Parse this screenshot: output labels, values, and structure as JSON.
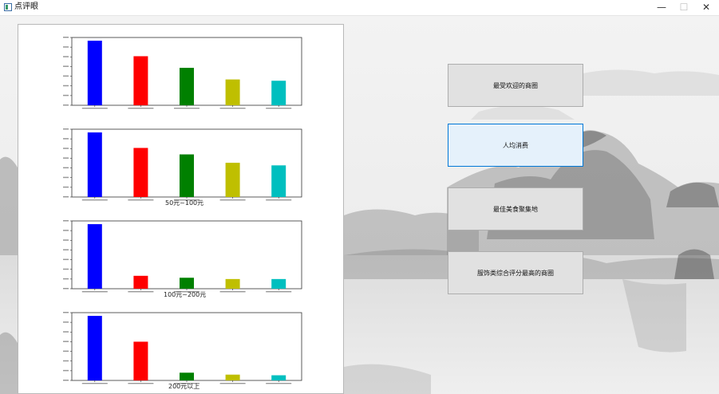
{
  "window": {
    "title": "点评眼",
    "minimize_glyph": "—",
    "maximize_glyph": "☐",
    "close_glyph": "✕",
    "icon": "app-window-icon"
  },
  "buttons": [
    {
      "label": "最受欢迎的商圈",
      "active": false
    },
    {
      "label": "人均消费",
      "active": true
    },
    {
      "label": "最佳美食聚集地",
      "active": false
    },
    {
      "label": "服饰类综合评分最高的商圈",
      "active": false
    }
  ],
  "colors": {
    "bar_colors": [
      "#0000ff",
      "#ff0000",
      "#008000",
      "#bfbf00",
      "#00bfbf"
    ],
    "active_border": "#0078d7",
    "active_fill": "#e5f1fb"
  },
  "chart_data": [
    {
      "type": "bar",
      "title": "",
      "categories": [
        "",
        "",
        "",
        "",
        ""
      ],
      "values": [
        100,
        76,
        58,
        40,
        38
      ],
      "ylim": [
        0,
        105
      ]
    },
    {
      "type": "bar",
      "title": "50元~100元",
      "categories": [
        "",
        "",
        "",
        "",
        ""
      ],
      "values": [
        100,
        76,
        66,
        53,
        49
      ],
      "ylim": [
        0,
        105
      ]
    },
    {
      "type": "bar",
      "title": "100元~200元",
      "categories": [
        "",
        "",
        "",
        "",
        ""
      ],
      "values": [
        100,
        20,
        17,
        15,
        15
      ],
      "ylim": [
        0,
        105
      ]
    },
    {
      "type": "bar",
      "title": "200元以上",
      "categories": [
        "",
        "",
        "",
        "",
        ""
      ],
      "values": [
        100,
        60,
        12,
        9,
        8
      ],
      "ylim": [
        0,
        105
      ]
    }
  ]
}
